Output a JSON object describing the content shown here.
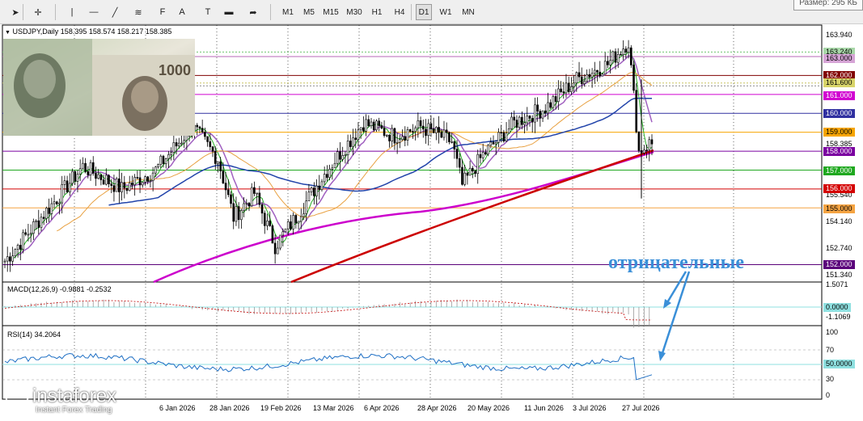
{
  "toolbar": {
    "tools": [
      {
        "name": "cursor-icon",
        "glyph": "➤"
      },
      {
        "name": "crosshair-icon",
        "glyph": "✛"
      },
      {
        "name": "vertical-line-icon",
        "glyph": "|"
      },
      {
        "name": "horizontal-line-icon",
        "glyph": "—"
      },
      {
        "name": "trendline-icon",
        "glyph": "╱"
      },
      {
        "name": "channel-icon",
        "glyph": "≋"
      },
      {
        "name": "fibonacci-icon",
        "glyph": "F"
      },
      {
        "name": "text-icon",
        "glyph": "A"
      },
      {
        "name": "text-label-icon",
        "glyph": "T"
      },
      {
        "name": "rectangle-icon",
        "glyph": "▬"
      },
      {
        "name": "arrows-icon",
        "glyph": "➦"
      }
    ],
    "timeframes": [
      "M1",
      "M5",
      "M15",
      "M30",
      "H1",
      "H4",
      "D1",
      "W1",
      "MN"
    ],
    "active_timeframe": "D1",
    "size_label": "Размер: 295 КБ"
  },
  "chart": {
    "symbol_header": "USDJPY,Daily  158.395 158.574 158.217 158.385",
    "macd_header": "MACD(12,26,9) -0.9881 -0.2532",
    "rsi_header": "RSI(14) 34.2064",
    "annotation": "отрицательные",
    "price_axis": [
      "163.940",
      "162.540",
      "159.740",
      "155.540",
      "154.140",
      "152.740",
      "151.340"
    ],
    "macd_axis": [
      "1.5071",
      "-1.1069"
    ],
    "rsi_axis": [
      "100",
      "70",
      "30",
      "0"
    ],
    "levels": [
      {
        "value": "163.240",
        "bg": "#a9d8a9",
        "fg": "#000"
      },
      {
        "value": "163.000",
        "bg": "#d6a4d6",
        "fg": "#000"
      },
      {
        "value": "162.000",
        "bg": "#800000",
        "fg": "#fff"
      },
      {
        "value": "161.600",
        "bg": "#d8d46a",
        "fg": "#000"
      },
      {
        "value": "161.000",
        "bg": "#d100d1",
        "fg": "#fff"
      },
      {
        "value": "160.000",
        "bg": "#3030a0",
        "fg": "#fff"
      },
      {
        "value": "159.000",
        "bg": "#f7a500",
        "fg": "#000"
      },
      {
        "value": "158.385",
        "bg": "#ffffff",
        "fg": "#000"
      },
      {
        "value": "158.000",
        "bg": "#7a00a0",
        "fg": "#fff"
      },
      {
        "value": "157.000",
        "bg": "#1fa81f",
        "fg": "#fff"
      },
      {
        "value": "156.000",
        "bg": "#d40000",
        "fg": "#fff"
      },
      {
        "value": "155.000",
        "bg": "#f5a442",
        "fg": "#000"
      },
      {
        "value": "152.000",
        "bg": "#5a007a",
        "fg": "#fff"
      },
      {
        "value": "0.0000",
        "bg": "#8fe0e0",
        "fg": "#000"
      },
      {
        "value": "50.0000",
        "bg": "#8fe0e0",
        "fg": "#000"
      }
    ],
    "dates": [
      "6 Jan 2026",
      "28 Jan 2026",
      "19 Feb 2026",
      "13 Mar 2026",
      "6 Apr 2026",
      "28 Apr 2026",
      "20 May 2026",
      "11 Jun 2026",
      "3 Jul 2026",
      "27 Jul 2026"
    ],
    "colors": {
      "macd_signal": "#c00000",
      "rsi": "#1e6fc4",
      "sma200": "#cc0000",
      "ma_magenta": "#cc00cc",
      "ma_blue": "#2244aa",
      "ma_orange": "#e8a040",
      "ma_green": "#22aa22",
      "ma_violet": "#a060c0"
    }
  },
  "branding": {
    "name": "instaforex",
    "tagline": "Instant Forex Trading"
  }
}
